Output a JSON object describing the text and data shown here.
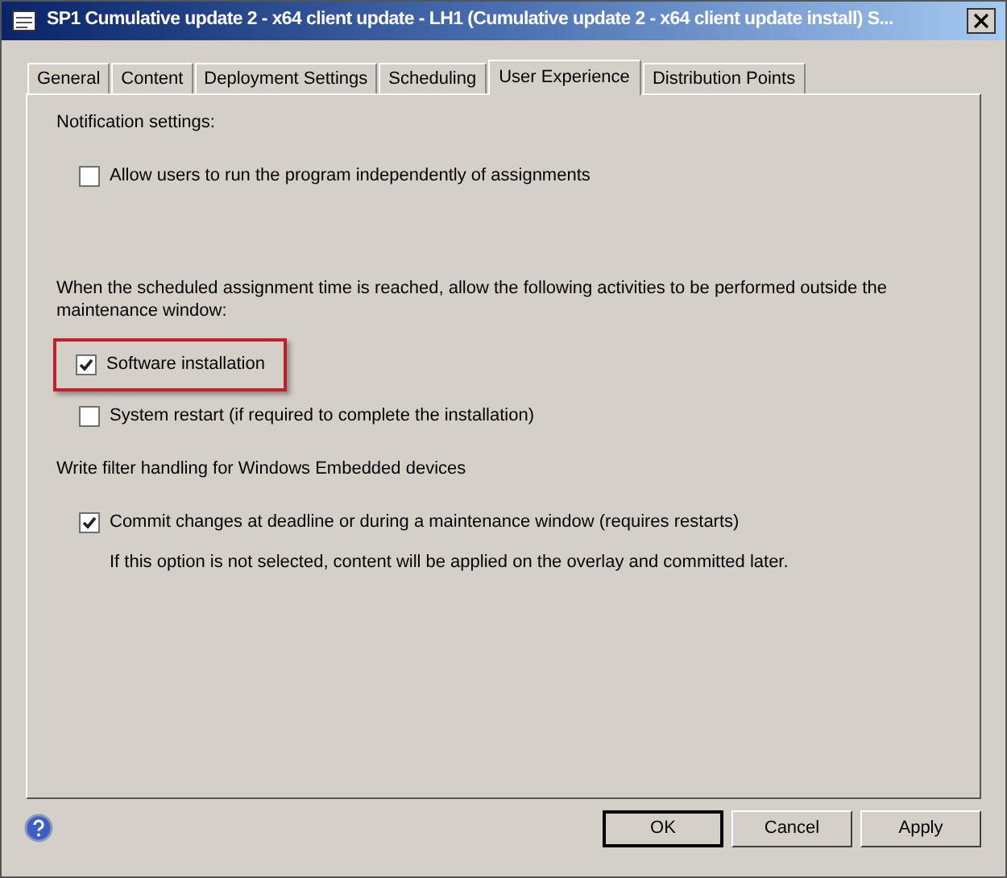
{
  "window": {
    "title": "SP1 Cumulative update 2 - x64 client update - LH1 (Cumulative update 2 - x64 client update install) S..."
  },
  "tabs": [
    {
      "label": "General",
      "selected": false
    },
    {
      "label": "Content",
      "selected": false
    },
    {
      "label": "Deployment Settings",
      "selected": false
    },
    {
      "label": "Scheduling",
      "selected": false
    },
    {
      "label": "User Experience",
      "selected": true
    },
    {
      "label": "Distribution Points",
      "selected": false
    }
  ],
  "sections": [
    {
      "heading": "Notification settings:",
      "options": [
        {
          "label": "Allow users to run the program independently of assignments",
          "checked": false,
          "highlighted": false
        }
      ]
    },
    {
      "heading": "When the scheduled assignment time is reached, allow the following activities to be performed outside the maintenance window:",
      "options": [
        {
          "label": "Software installation",
          "checked": true,
          "highlighted": true
        },
        {
          "label": "System restart (if required to complete the installation)",
          "checked": false,
          "highlighted": false
        }
      ]
    },
    {
      "heading": "Write filter handling for Windows Embedded devices",
      "options": [
        {
          "label": "Commit changes at deadline or during a maintenance window (requires restarts)",
          "checked": true,
          "highlighted": false,
          "note": "If this option is not selected, content will be applied on the overlay and committed later."
        }
      ]
    }
  ],
  "buttons": [
    {
      "label": "OK",
      "default": true
    },
    {
      "label": "Cancel",
      "default": false
    },
    {
      "label": "Apply",
      "default": false
    }
  ]
}
